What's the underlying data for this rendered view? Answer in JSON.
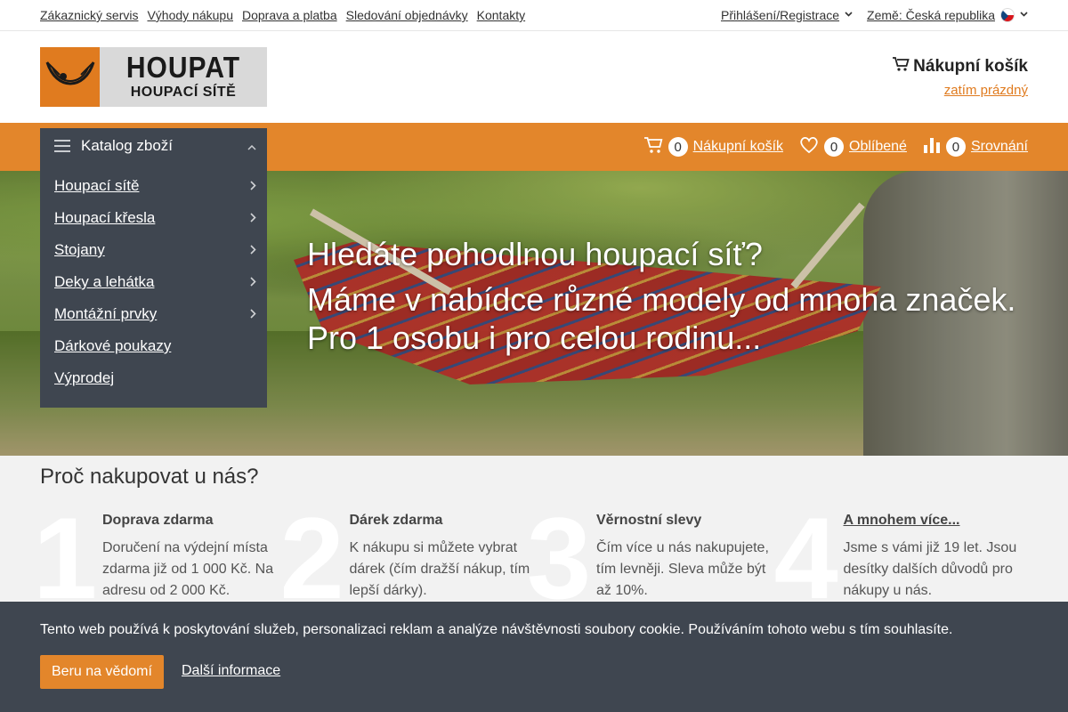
{
  "topbar": {
    "links": [
      "Zákaznický servis",
      "Výhody nákupu",
      "Doprava a platba",
      "Sledování objednávky",
      "Kontakty"
    ],
    "login": "Přihlášení/Registrace",
    "country": "Země: Česká republika"
  },
  "logo": {
    "big": "HOUPAT",
    "small": "HOUPACÍ SÍTĚ"
  },
  "cart_header": {
    "title": "Nákupní košík",
    "status": "zatím prázdný"
  },
  "nav": {
    "catalog_title": "Katalog zboží",
    "cart": {
      "count": "0",
      "label": "Nákupní košík"
    },
    "favorites": {
      "count": "0",
      "label": "Oblíbené"
    },
    "compare": {
      "count": "0",
      "label": "Srovnání"
    }
  },
  "catalog": {
    "items": [
      {
        "label": "Houpací sítě",
        "has_sub": true
      },
      {
        "label": "Houpací křesla",
        "has_sub": true
      },
      {
        "label": "Stojany",
        "has_sub": true
      },
      {
        "label": "Deky a lehátka",
        "has_sub": true
      },
      {
        "label": "Montážní prvky",
        "has_sub": true
      },
      {
        "label": "Dárkové poukazy",
        "has_sub": false
      },
      {
        "label": "Výprodej",
        "has_sub": false
      }
    ]
  },
  "hero": {
    "line1": "Hledáte pohodlnou houpací síť?",
    "line2": "Máme v nabídce různé modely od mnoha značek.",
    "line3": "Pro 1 osobu i pro celou rodinu..."
  },
  "why": {
    "title": "Proč nakupovat u nás?",
    "features": [
      {
        "num": "1",
        "title": "Doprava zdarma",
        "desc": "Doručení na výdejní místa zdarma již od 1 000 Kč. Na adresu od 2 000 Kč.",
        "link": false
      },
      {
        "num": "2",
        "title": "Dárek zdarma",
        "desc": "K nákupu si můžete vybrat dárek (čím dražší nákup, tím lepší dárky).",
        "link": false
      },
      {
        "num": "3",
        "title": "Věrnostní slevy",
        "desc": "Čím více u nás nakupujete, tím levněji. Sleva může být až 10%.",
        "link": false
      },
      {
        "num": "4",
        "title": "A mnohem více...",
        "desc": "Jsme s vámi již 19 let. Jsou desítky dalších důvodů pro nákupy u nás.",
        "link": true
      }
    ]
  },
  "cookie": {
    "message": "Tento web používá k poskytování služeb, personalizaci reklam a analýze návštěvnosti soubory cookie. Používáním tohoto webu s tím souhlasíte.",
    "accept": "Beru na vědomí",
    "more": "Další informace"
  },
  "colors": {
    "accent": "#e3862b",
    "dark": "#3f4650",
    "light_bg": "#f2f2f2"
  },
  "icons": [
    "chevron-down-icon",
    "czech-flag-icon",
    "cart-icon",
    "menu-icon",
    "chevron-up-icon",
    "chevron-right-icon",
    "heart-icon",
    "bar-chart-icon"
  ]
}
